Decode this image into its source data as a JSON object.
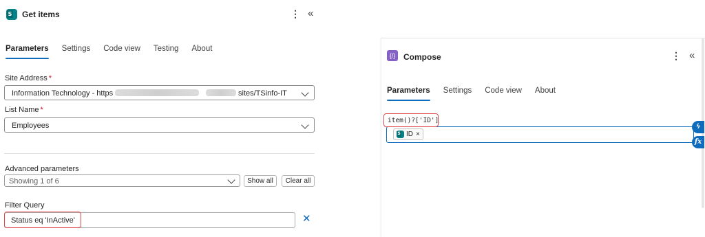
{
  "left_panel": {
    "title": "Get items",
    "more_icon": "more-vertical-icon",
    "collapse_icon": "collapse-chevrons-icon",
    "tabs": [
      "Parameters",
      "Settings",
      "Code view",
      "Testing",
      "About"
    ],
    "active_tab": "Parameters",
    "site_address": {
      "label": "Site Address",
      "required_mark": "*",
      "value_start": "Information Technology - https",
      "value_end": "sites/TSinfo-IT"
    },
    "list_name": {
      "label": "List Name",
      "required_mark": "*",
      "value": "Employees"
    },
    "advanced": {
      "label": "Advanced parameters",
      "select_value": "Showing 1 of 6",
      "show_all": "Show all",
      "clear_all": "Clear all"
    },
    "filter_query": {
      "label": "Filter Query",
      "value": "Status eq 'InActive'",
      "clear_icon": "close-icon"
    }
  },
  "right_panel": {
    "title": "Compose",
    "icon": "compose-icon",
    "icon_text": "{/}",
    "tabs": [
      "Parameters",
      "Settings",
      "Code view",
      "About"
    ],
    "active_tab": "Parameters",
    "expression": "item()?['ID']",
    "token_label": "ID",
    "token_remove": "×",
    "dynamic_content_icon": "lightning-icon",
    "expression_icon_text": "fx"
  },
  "colors": {
    "accent": "#0f6cbd",
    "highlight": "#e0454a",
    "sharepoint": "#038387",
    "compose": "#8661c5"
  }
}
